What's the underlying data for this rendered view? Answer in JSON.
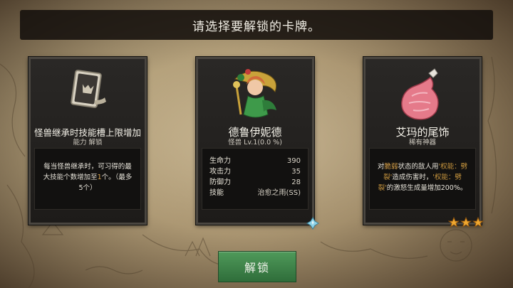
{
  "banner": {
    "text": "请选择要解锁的卡牌。"
  },
  "cards": [
    {
      "title": "怪兽继承时技能槽上限增加",
      "subtitle": "能力 解锁",
      "desc_parts": [
        "每当怪兽继承时，可习得的最大技能个数增加至",
        "1",
        "个。（最多5个）"
      ],
      "icon": "skill-card-icon"
    },
    {
      "title": "德鲁伊妮德",
      "subtitle": "怪兽 Lv.1(0.0 %)",
      "stats": [
        {
          "label": "生命力",
          "value": "390"
        },
        {
          "label": "攻击力",
          "value": "35"
        },
        {
          "label": "防御力",
          "value": "28"
        },
        {
          "label": "技能",
          "value": "治愈之雨(SS)"
        }
      ],
      "icon": "druid-portrait",
      "badge": "diamond-gem-icon"
    },
    {
      "title": "艾玛的尾饰",
      "subtitle": "稀有神器",
      "desc_parts": [
        "对",
        "脆弱",
        "状态的敌人用",
        "'权能：劈裂'",
        "造成伤害时，",
        "'权能：劈裂'",
        "的激怒生成量增加200%。"
      ],
      "icon": "tail-ornament-icon",
      "stars": 3
    }
  ],
  "button": {
    "label": "解锁"
  },
  "colors": {
    "highlight": "#d9a24a",
    "button": "#3f8a4b"
  }
}
